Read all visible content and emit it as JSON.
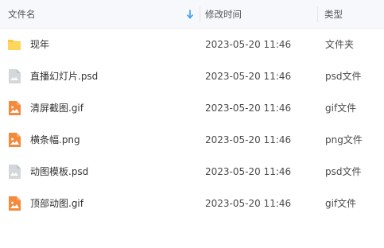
{
  "header": {
    "name_label": "文件名",
    "date_label": "修改时间",
    "type_label": "类型",
    "sort_icon": "arrow-down-icon",
    "accent_color": "#3a9cf5"
  },
  "files": [
    {
      "name": "现年",
      "date": "2023-05-20 11:46",
      "type": "文件夹",
      "icon": "folder-icon"
    },
    {
      "name": "直播幻灯片.psd",
      "date": "2023-05-20 11:46",
      "type": "psd文件",
      "icon": "psd-file-icon"
    },
    {
      "name": "清屏截图.gif",
      "date": "2023-05-20 11:46",
      "type": "gif文件",
      "icon": "image-file-icon"
    },
    {
      "name": "横条幅.png",
      "date": "2023-05-20 11:46",
      "type": "png文件",
      "icon": "image-file-icon"
    },
    {
      "name": "动图模板.psd",
      "date": "2023-05-20 11:46",
      "type": "psd文件",
      "icon": "psd-file-icon"
    },
    {
      "name": "顶部动图.gif",
      "date": "2023-05-20 11:46",
      "type": "gif文件",
      "icon": "image-file-icon"
    }
  ],
  "colors": {
    "folder": "#ffc83d",
    "image_file": "#f58a3d",
    "psd_file": "#d5d7da"
  }
}
